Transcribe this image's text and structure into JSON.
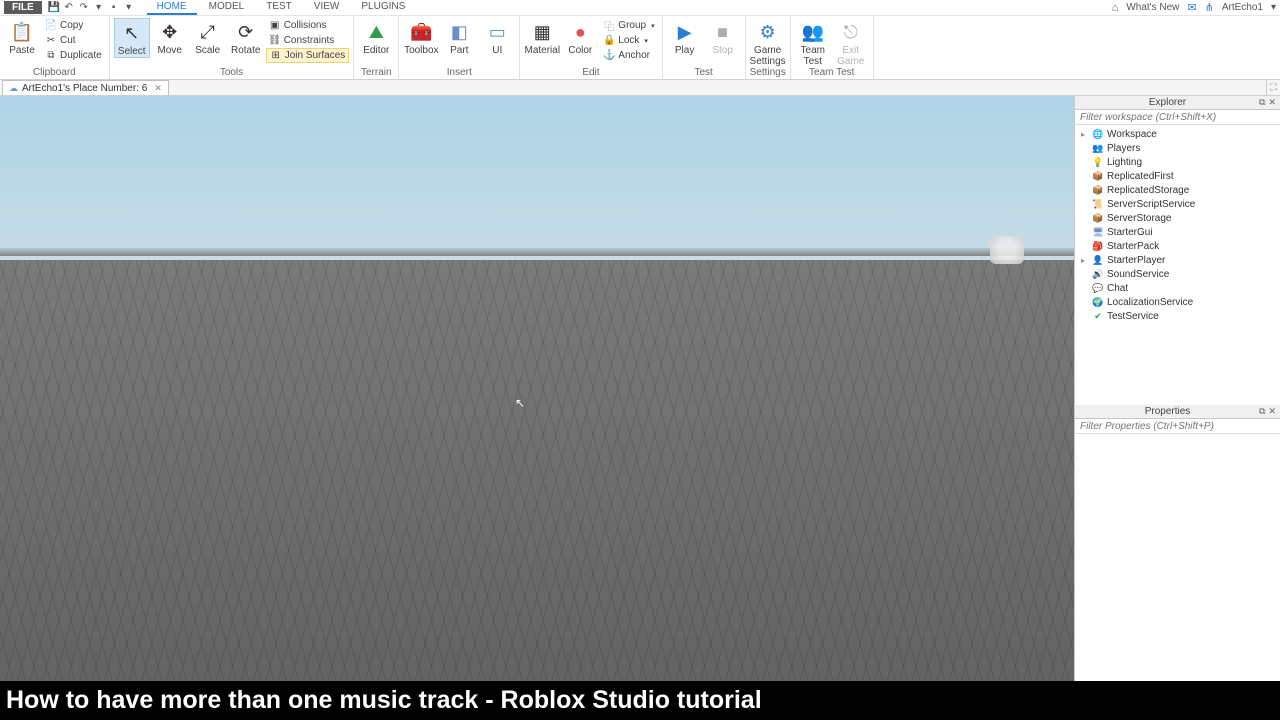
{
  "menubar": {
    "file": "FILE",
    "tabs": [
      "HOME",
      "MODEL",
      "TEST",
      "VIEW",
      "PLUGINS"
    ],
    "active_tab": 0,
    "whats_new": "What's New",
    "username": "ArtEcho1"
  },
  "ribbon": {
    "clipboard": {
      "label": "Clipboard",
      "paste": "Paste",
      "copy": "Copy",
      "cut": "Cut",
      "duplicate": "Duplicate"
    },
    "tools": {
      "label": "Tools",
      "select": "Select",
      "move": "Move",
      "scale": "Scale",
      "rotate": "Rotate",
      "collisions": "Collisions",
      "constraints": "Constraints",
      "join": "Join Surfaces"
    },
    "terrain": {
      "label": "Terrain",
      "editor": "Editor"
    },
    "insert": {
      "label": "Insert",
      "toolbox": "Toolbox",
      "part": "Part",
      "ui": "UI"
    },
    "edit": {
      "label": "Edit",
      "material": "Material",
      "color": "Color",
      "group": "Group",
      "lock": "Lock",
      "anchor": "Anchor"
    },
    "test": {
      "label": "Test",
      "play": "Play",
      "stop": "Stop"
    },
    "settings": {
      "label": "Settings",
      "game": "Game\nSettings"
    },
    "teamtest": {
      "label": "Team Test",
      "team": "Team\nTest",
      "exit": "Exit\nGame"
    }
  },
  "doctab": {
    "title": "ArtEcho1's Place Number: 6"
  },
  "explorer": {
    "title": "Explorer",
    "filter_placeholder": "Filter workspace (Ctrl+Shift+X)",
    "items": [
      {
        "name": "Workspace",
        "icon": "🌐",
        "color": "#2e9e4a",
        "expandable": true
      },
      {
        "name": "Players",
        "icon": "👥",
        "color": "#7a7a7a"
      },
      {
        "name": "Lighting",
        "icon": "💡",
        "color": "#e8b84a"
      },
      {
        "name": "ReplicatedFirst",
        "icon": "📦",
        "color": "#c08850"
      },
      {
        "name": "ReplicatedStorage",
        "icon": "📦",
        "color": "#c08850"
      },
      {
        "name": "ServerScriptService",
        "icon": "📜",
        "color": "#6a8fc4"
      },
      {
        "name": "ServerStorage",
        "icon": "📦",
        "color": "#c08850"
      },
      {
        "name": "StarterGui",
        "icon": "🖥",
        "color": "#6a8fc4"
      },
      {
        "name": "StarterPack",
        "icon": "🎒",
        "color": "#c08850"
      },
      {
        "name": "StarterPlayer",
        "icon": "👤",
        "color": "#d07a50",
        "expandable": true
      },
      {
        "name": "SoundService",
        "icon": "🔊",
        "color": "#7a7a7a"
      },
      {
        "name": "Chat",
        "icon": "💬",
        "color": "#7a7a7a"
      },
      {
        "name": "LocalizationService",
        "icon": "🌍",
        "color": "#4a8fc4"
      },
      {
        "name": "TestService",
        "icon": "✔",
        "color": "#2e9e4a"
      }
    ]
  },
  "properties": {
    "title": "Properties",
    "filter_placeholder": "Filter Properties (Ctrl+Shift+P)"
  },
  "caption": "How to have more than one music track - Roblox Studio tutorial"
}
